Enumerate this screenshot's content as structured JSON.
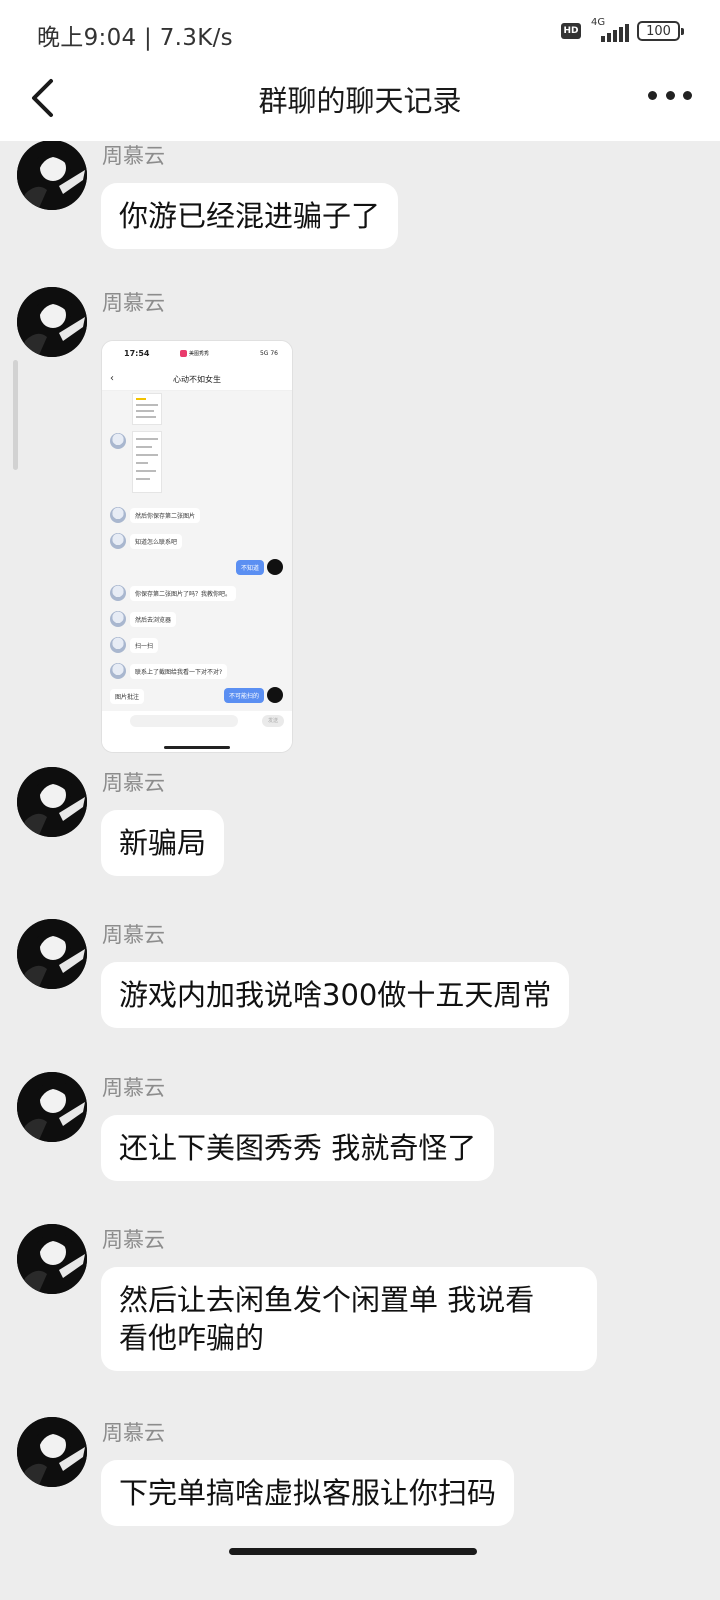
{
  "status_bar": {
    "time_speed": "晚上9:04 | 7.3K/s",
    "hd": "HD",
    "network": "4G",
    "battery": "100"
  },
  "header": {
    "title": "群聊的聊天记录",
    "back_icon": "chevron-left-icon",
    "more_icon": "more-dots-icon"
  },
  "messages": [
    {
      "sender": "周慕云",
      "text": "你游已经混进骗子了"
    },
    {
      "sender": "周慕云",
      "type": "image"
    },
    {
      "sender": "周慕云",
      "text": "新骗局"
    },
    {
      "sender": "周慕云",
      "text": "游戏内加我说啥300做十五天周常"
    },
    {
      "sender": "周慕云",
      "text": "还让下美图秀秀 我就奇怪了"
    },
    {
      "sender": "周慕云",
      "text": "然后让去闲鱼发个闲置单 我说看\n看他咋骗的"
    },
    {
      "sender": "周慕云",
      "text": "下完单搞啥虚拟客服让你扫码"
    }
  ],
  "screenshot": {
    "time": "17:54",
    "app": "美图秀秀",
    "net": "5G 76",
    "title": "心动不如女生",
    "chat": [
      {
        "side": "left",
        "text": "然后你保存第二张图片"
      },
      {
        "side": "left",
        "text": "知道怎么联系吧"
      },
      {
        "side": "right",
        "text": "不知道"
      },
      {
        "side": "left",
        "text": "你保存第二张图片了吗？我教你吧。"
      },
      {
        "side": "left",
        "text": "然后去浏览器"
      },
      {
        "side": "left",
        "text": "扫一扫"
      },
      {
        "side": "left",
        "text": "联系上了截图给我看一下对不对?"
      },
      {
        "side": "right",
        "text": "不可能扫的"
      }
    ],
    "image_note": "图片批注",
    "send": "发送"
  }
}
